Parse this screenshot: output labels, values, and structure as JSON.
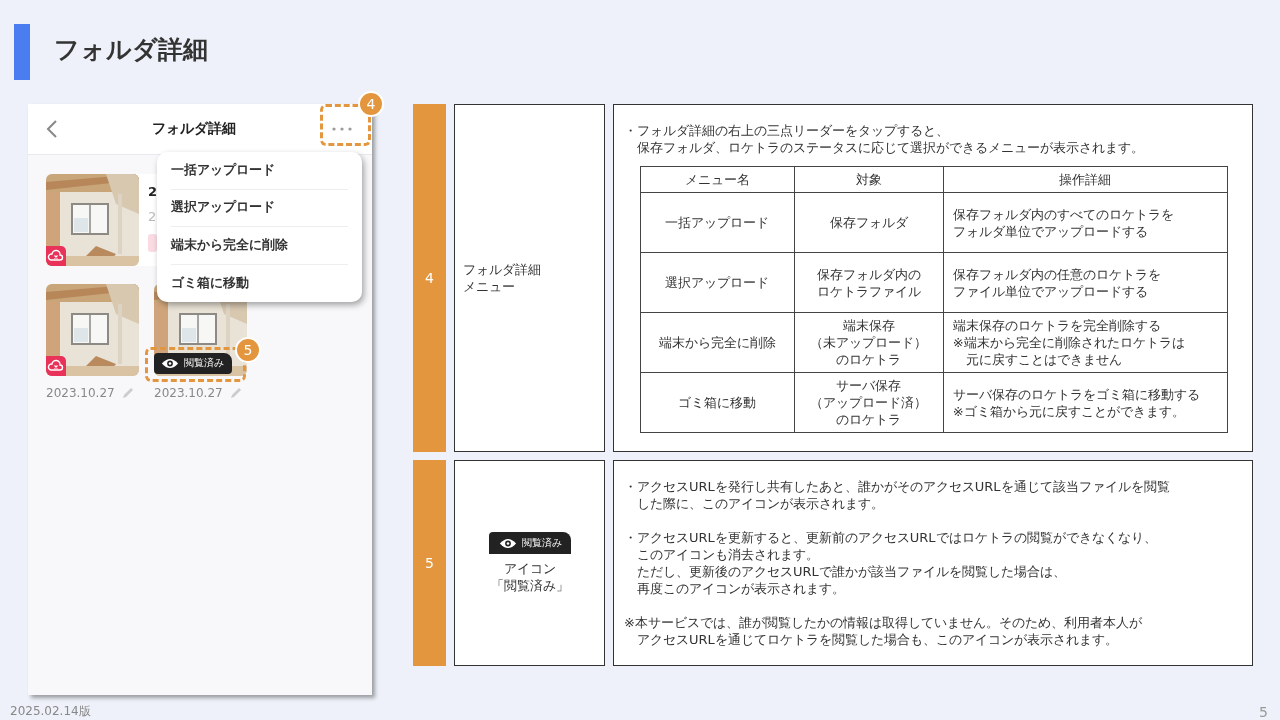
{
  "title": "フォルダ詳細",
  "phone": {
    "title": "フォルダ詳細",
    "menu_callout": "4",
    "items": [
      {
        "kind": "card",
        "title": "2",
        "subtitle": "2",
        "not_uploaded": true
      },
      {
        "kind": "tile",
        "date": "2023.10.27",
        "not_uploaded": true,
        "viewed": false
      },
      {
        "kind": "tile",
        "date": "2023.10.27",
        "viewed": true,
        "viewed_label": "閲覧済み",
        "callout": "5"
      }
    ],
    "menu": [
      "一括アップロード",
      "選択アップロード",
      "端末から完全に削除",
      "ゴミ箱に移動"
    ]
  },
  "sections": [
    {
      "number": "4",
      "kind": "table",
      "label": [
        "フォルダ詳細",
        "メニュー"
      ],
      "intro": [
        [
          "・フォルダ詳細の右上の三点リーダーをタップすると、",
          "保存フォルダ、ロケトラのステータスに応じて選択ができるメニューが表示されます。"
        ]
      ],
      "table": {
        "columns": [
          "メニュー名",
          "対象",
          "操作詳細"
        ],
        "rows": [
          [
            [
              "一括アップロード"
            ],
            [
              "保存フォルダ"
            ],
            [
              [
                "保存フォルダ内のすべてのロケトラを"
              ],
              [
                "フォルダ単位でアップロードする"
              ]
            ]
          ],
          [
            [
              "選択アップロード"
            ],
            [
              "保存フォルダ内の",
              "ロケトラファイル"
            ],
            [
              [
                "保存フォルダ内の任意のロケトラを"
              ],
              [
                "ファイル単位でアップロードする"
              ]
            ]
          ],
          [
            [
              "端末から完全に削除"
            ],
            [
              "端末保存",
              "（未アップロード）",
              "のロケトラ"
            ],
            [
              [
                "端末保存のロケトラを完全削除する"
              ],
              [
                "※端末から完全に削除されたロケトラは",
                "元に戻すことはできません"
              ]
            ]
          ],
          [
            [
              "ゴミ箱に移動"
            ],
            [
              "サーバ保存",
              "（アップロード済）",
              "のロケトラ"
            ],
            [
              [
                "サーバ保存のロケトラをゴミ箱に移動する"
              ],
              [
                "※ゴミ箱から元に戻すことができます。"
              ]
            ]
          ]
        ]
      }
    },
    {
      "number": "5",
      "kind": "notes",
      "icon_label": "閲覧済み",
      "label": [
        "アイコン",
        "「閲覧済み」"
      ],
      "notes": [
        [
          "・アクセスURLを発行し共有したあと、誰かがそのアクセスURLを通じて該当ファイルを閲覧",
          "した際に、このアイコンが表示されます。"
        ],
        [
          "・アクセスURLを更新すると、更新前のアクセスURLではロケトラの閲覧ができなくなり、",
          "このアイコンも消去されます。",
          "ただし、更新後のアクセスURLで誰かが該当ファイルを閲覧した場合は、",
          "再度このアイコンが表示されます。"
        ],
        [
          "※本サービスでは、誰が閲覧したかの情報は取得していません。そのため、利用者本人が",
          "アクセスURLを通じてロケトラを閲覧した場合も、このアイコンが表示されます。"
        ]
      ]
    }
  ],
  "footer": {
    "version": "2025.02.14版",
    "page": "5"
  }
}
